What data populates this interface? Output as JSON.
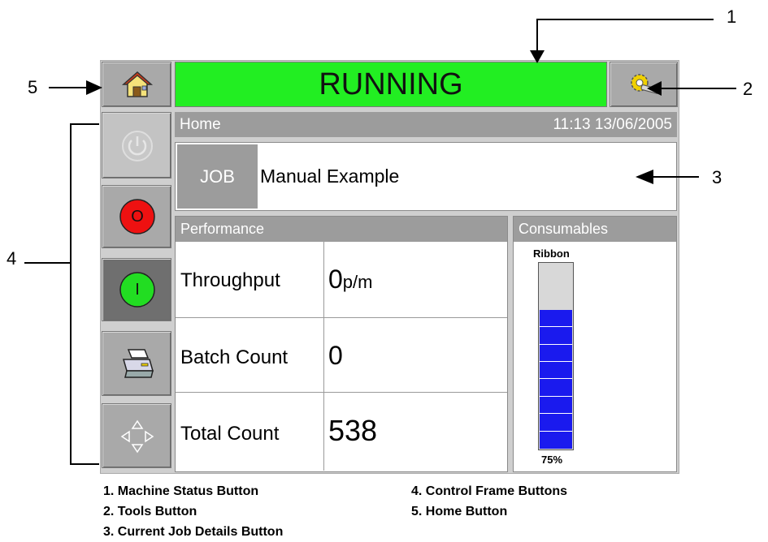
{
  "status": {
    "label": "RUNNING",
    "color": "#22ee22"
  },
  "header": {
    "screen": "Home",
    "datetime": "11:13 13/06/2005"
  },
  "job": {
    "label": "JOB",
    "name": "Manual Example"
  },
  "performance": {
    "title": "Performance",
    "rows": [
      {
        "label": "Throughput",
        "value": "0",
        "unit": "p/m"
      },
      {
        "label": "Batch Count",
        "value": "0",
        "unit": ""
      },
      {
        "label": "Total Count",
        "value": "538",
        "unit": ""
      }
    ]
  },
  "consumables": {
    "title": "Consumables",
    "ribbon_label": "Ribbon",
    "ribbon_percent": "75%",
    "ribbon_level": 0.75,
    "fill_color": "#1a1aee"
  },
  "control_buttons": [
    {
      "icon": "power-icon",
      "state": "disabled"
    },
    {
      "icon": "stop-icon",
      "text": "O",
      "color": "#ee1111"
    },
    {
      "icon": "start-icon",
      "text": "I",
      "color": "#22dd22"
    },
    {
      "icon": "printer-icon"
    },
    {
      "icon": "navigation-arrows-icon"
    }
  ],
  "callouts": [
    "1",
    "2",
    "3",
    "4",
    "5"
  ],
  "legend": [
    "1. Machine Status Button",
    "2. Tools Button",
    "3. Current Job Details Button",
    "4. Control Frame Buttons",
    "5. Home Button"
  ]
}
